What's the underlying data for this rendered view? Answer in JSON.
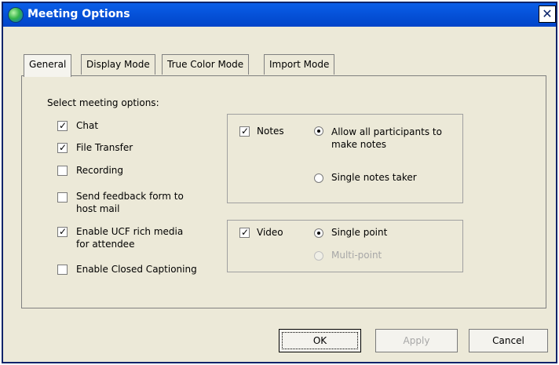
{
  "window": {
    "title": "Meeting Options",
    "close_icon": "✕"
  },
  "tabs": [
    {
      "label": "General",
      "active": true
    },
    {
      "label": "Display Mode",
      "active": false
    },
    {
      "label": "True Color Mode",
      "active": false
    },
    {
      "label": "Import Mode",
      "active": false
    }
  ],
  "general": {
    "heading": "Select meeting options:",
    "options": [
      {
        "label": "Chat",
        "checked": true
      },
      {
        "label": "File Transfer",
        "checked": true
      },
      {
        "label": "Recording",
        "checked": false
      },
      {
        "label_line1": "Send feedback form to",
        "label_line2": "host mail",
        "checked": false
      },
      {
        "label_line1": "Enable UCF rich media",
        "label_line2": "for attendee",
        "checked": true
      },
      {
        "label": "Enable Closed Captioning",
        "checked": false
      }
    ],
    "check_mark": "✓",
    "notes": {
      "label": "Notes",
      "checked": true,
      "option1_line1": "Allow all participants to",
      "option1_line2": "make notes",
      "option2": "Single notes taker",
      "selected": 1
    },
    "video": {
      "label": "Video",
      "checked": true,
      "option1": "Single point",
      "option2": "Multi-point",
      "option2_disabled": true,
      "selected": 1
    }
  },
  "buttons": {
    "ok": "OK",
    "apply": "Apply",
    "cancel": "Cancel"
  }
}
